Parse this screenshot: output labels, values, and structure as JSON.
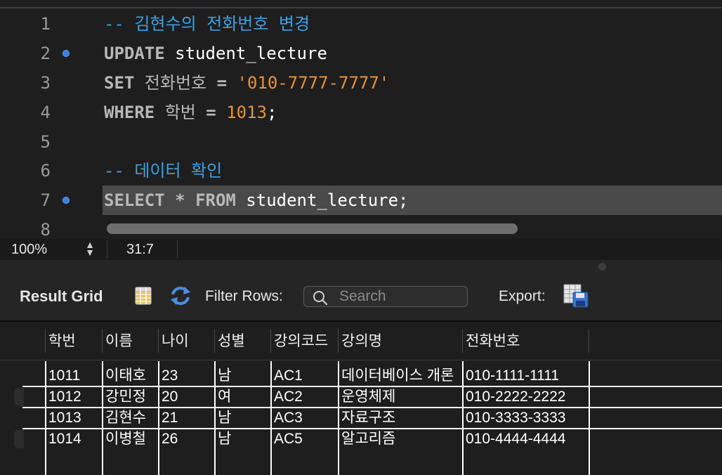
{
  "editor": {
    "lines": [
      {
        "n": "1",
        "breakpoint": false,
        "parts": [
          {
            "t": "-- 김현수의 전화번호 변경",
            "c": "cmt"
          }
        ]
      },
      {
        "n": "2",
        "breakpoint": true,
        "parts": [
          {
            "t": "UPDATE",
            "c": "kw"
          },
          {
            "t": " student_lecture",
            "c": ""
          }
        ]
      },
      {
        "n": "3",
        "breakpoint": false,
        "parts": [
          {
            "t": "SET",
            "c": "kw"
          },
          {
            "t": " 전화번호",
            "c": "ident-kr"
          },
          {
            "t": " = ",
            "c": "kw"
          },
          {
            "t": "'010-7777-7777'",
            "c": "str"
          }
        ]
      },
      {
        "n": "4",
        "breakpoint": false,
        "parts": [
          {
            "t": "WHERE",
            "c": "kw"
          },
          {
            "t": " 학번",
            "c": "ident-kr"
          },
          {
            "t": " = ",
            "c": "kw"
          },
          {
            "t": "1013",
            "c": "num"
          },
          {
            "t": ";",
            "c": ""
          }
        ]
      },
      {
        "n": "5",
        "breakpoint": false,
        "parts": []
      },
      {
        "n": "6",
        "breakpoint": false,
        "parts": [
          {
            "t": "-- 데이터 확인",
            "c": "cmt"
          }
        ]
      },
      {
        "n": "7",
        "breakpoint": true,
        "parts": [
          {
            "t": "SELECT",
            "c": "kw"
          },
          {
            "t": " * ",
            "c": "kw"
          },
          {
            "t": "FROM",
            "c": "kw"
          },
          {
            "t": " student_lecture;",
            "c": ""
          }
        ]
      },
      {
        "n": "8",
        "breakpoint": false,
        "parts": []
      }
    ],
    "current_line": "7"
  },
  "status": {
    "zoom": "100%",
    "cursor_position": "31:7"
  },
  "toolbar": {
    "title": "Result Grid",
    "filter_label": "Filter Rows:",
    "search_placeholder": "Search",
    "export_label": "Export:",
    "icons": [
      "grid-view-icon",
      "refresh-icon",
      "search-icon",
      "export-icon"
    ]
  },
  "grid": {
    "columns": [
      "학번",
      "이름",
      "나이",
      "성별",
      "강의코드",
      "강의명",
      "전화번호"
    ],
    "rows": [
      [
        "1011",
        "이태호",
        "23",
        "남",
        "AC1",
        "데이터베이스 개론",
        "010-1111-1111"
      ],
      [
        "1012",
        "강민정",
        "20",
        "여",
        "AC2",
        "운영체제",
        "010-2222-2222"
      ],
      [
        "1013",
        "김현수",
        "21",
        "남",
        "AC3",
        "자료구조",
        "010-3333-3333"
      ],
      [
        "1014",
        "이병철",
        "26",
        "남",
        "AC5",
        "알고리즘",
        "010-4444-4444"
      ]
    ]
  },
  "colors": {
    "comment": "#3ea0e0",
    "literal": "#e8913a",
    "keyword": "#b8b8b8",
    "breakpoint": "#3b7fe0"
  }
}
